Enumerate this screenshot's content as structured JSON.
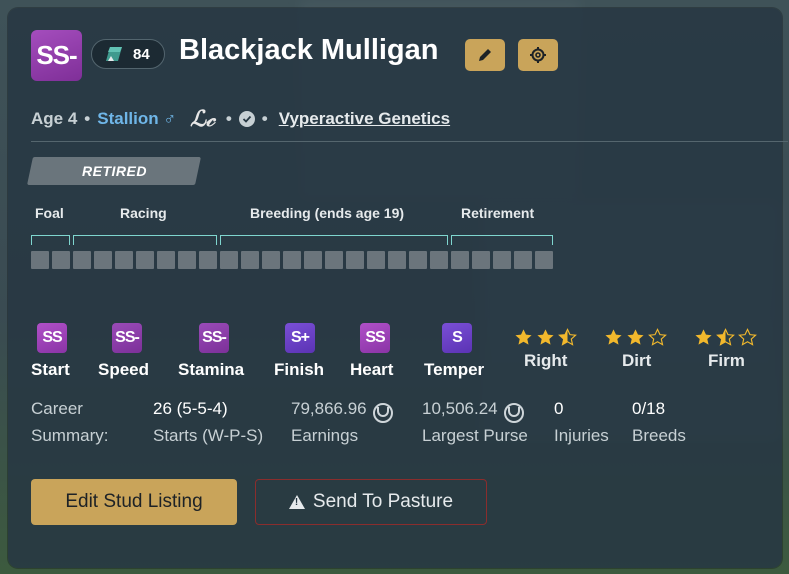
{
  "horse": {
    "grade": "SS-",
    "rating": "84",
    "name": "Blackjack Mulligan",
    "age": "Age 4",
    "gender": "Stallion ♂",
    "lc": "ℒ𝒸",
    "breeder": "Vyperactive Genetics"
  },
  "status": {
    "label": "RETIRED"
  },
  "lifecycle": {
    "stages": [
      "Foal",
      "Racing",
      "Breeding (ends age 19)",
      "Retirement"
    ],
    "segment_count": 25
  },
  "attributes": [
    {
      "grade": "SS",
      "label": "Start"
    },
    {
      "grade": "SS-",
      "label": "Speed"
    },
    {
      "grade": "SS-",
      "label": "Stamina"
    },
    {
      "grade": "S+",
      "label": "Finish"
    },
    {
      "grade": "SS",
      "label": "Heart"
    },
    {
      "grade": "S",
      "label": "Temper"
    }
  ],
  "preferences": [
    {
      "label": "Right",
      "stars": 2.5
    },
    {
      "label": "Dirt",
      "stars": 2
    },
    {
      "label": "Firm",
      "stars": 1.5
    }
  ],
  "summary": {
    "title_line1": "Career",
    "title_line2": "Summary:",
    "starts_value": "26 (5-5-4)",
    "starts_label": "Starts (W-P-S)",
    "earnings_value": "79,866.96",
    "earnings_label": "Earnings",
    "purse_value": "10,506.24",
    "purse_label": "Largest Purse",
    "injuries_value": "0",
    "injuries_label": "Injuries",
    "breeds_value": "0/18",
    "breeds_label": "Breeds"
  },
  "actions": {
    "edit_stud": "Edit Stud Listing",
    "send_pasture": "Send To Pasture"
  },
  "colors": {
    "gold": "#c9a45a",
    "star": "#f2b82c",
    "star_empty": "#2a3e46",
    "bracket": "#7fd6cf",
    "danger_border": "#8a2d2d"
  }
}
